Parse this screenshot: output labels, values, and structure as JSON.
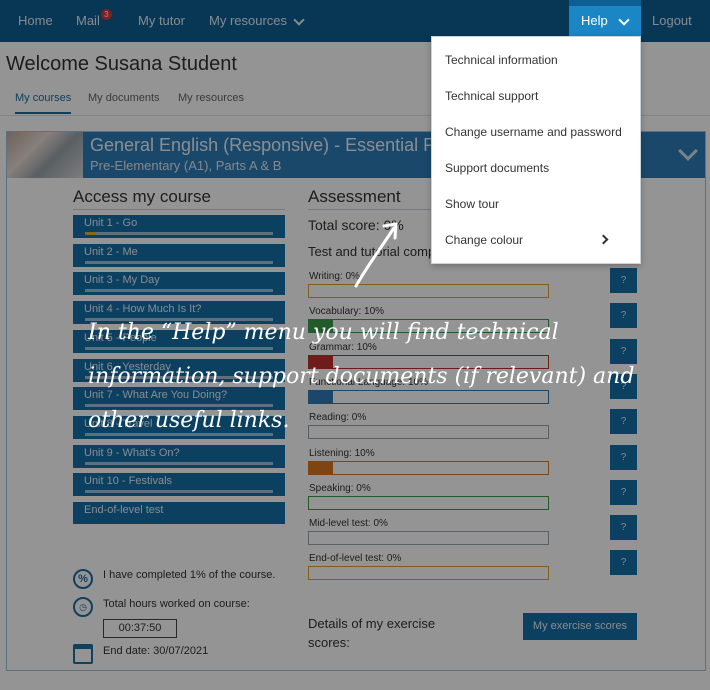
{
  "nav": {
    "home": "Home",
    "mail": "Mail",
    "mail_count": "3",
    "my_tutor": "My tutor",
    "my_resources": "My resources",
    "help": "Help",
    "logout": "Logout"
  },
  "welcome": "Welcome Susana Student",
  "tabs": [
    "My courses",
    "My documents",
    "My resources"
  ],
  "course": {
    "title": "General English (Responsive) - Essential Plus",
    "subtitle": "Pre-Elementary (A1), Parts A & B"
  },
  "access": {
    "title": "Access my course",
    "units": [
      {
        "label": "Unit 1 - Go",
        "progress": 0.06
      },
      {
        "label": "Unit 2 - Me",
        "progress": 0
      },
      {
        "label": "Unit 3 - My Day",
        "progress": 0
      },
      {
        "label": "Unit 4 - How Much Is It?",
        "progress": 0
      },
      {
        "label": "Unit 5 - People",
        "progress": 0
      },
      {
        "label": "Unit 6 - Yesterday",
        "progress": 0
      },
      {
        "label": "Unit 7 - What Are You Doing?",
        "progress": 0
      },
      {
        "label": "Unit 8 - Travel",
        "progress": 0
      },
      {
        "label": "Unit 9 - What's On?",
        "progress": 0
      },
      {
        "label": "Unit 10 - Festivals",
        "progress": 0
      },
      {
        "label": "End-of-level test",
        "progress": null
      }
    ],
    "completed_text": "I have completed 1% of the course.",
    "hours_label": "Total hours worked on course:",
    "hours_value": "00:37:50",
    "end_date": "End date: 30/07/2021",
    "percent_symbol": "%"
  },
  "assessment": {
    "title": "Assessment",
    "total_score": "Total score: 0%",
    "test_label": "Test and tutorial completion",
    "rows": [
      {
        "label": "Writing: 0%",
        "value": 0,
        "color": "#e0a12a"
      },
      {
        "label": "Vocabulary: 10%",
        "value": 10,
        "color": "#3a9b4a"
      },
      {
        "label": "Grammar: 10%",
        "value": 10,
        "color": "#c0302b"
      },
      {
        "label": "Functional Language: 10%",
        "value": 10,
        "color": "#2f7ab8"
      },
      {
        "label": "Reading: 0%",
        "value": 0,
        "color": "#9aa5ad"
      },
      {
        "label": "Listening: 10%",
        "value": 10,
        "color": "#d9781f"
      },
      {
        "label": "Speaking: 0%",
        "value": 0,
        "color": "#3a9b4a"
      },
      {
        "label": "Mid-level test: 0%",
        "value": 0,
        "color": "#9aa5ad"
      },
      {
        "label": "End-of-level test: 0%",
        "value": 0,
        "color": "#e0a12a"
      }
    ],
    "q_label": "?",
    "details_label": "Details of my exercise scores:",
    "scores_button": "My exercise scores"
  },
  "help_menu": {
    "items": [
      "Technical information",
      "Technical support",
      "Change username and password",
      "Support documents",
      "Show tour",
      "Change colour"
    ]
  },
  "tour": {
    "text": "In the “Help” menu you will find technical information, support documents (if relevant) and other useful links."
  }
}
